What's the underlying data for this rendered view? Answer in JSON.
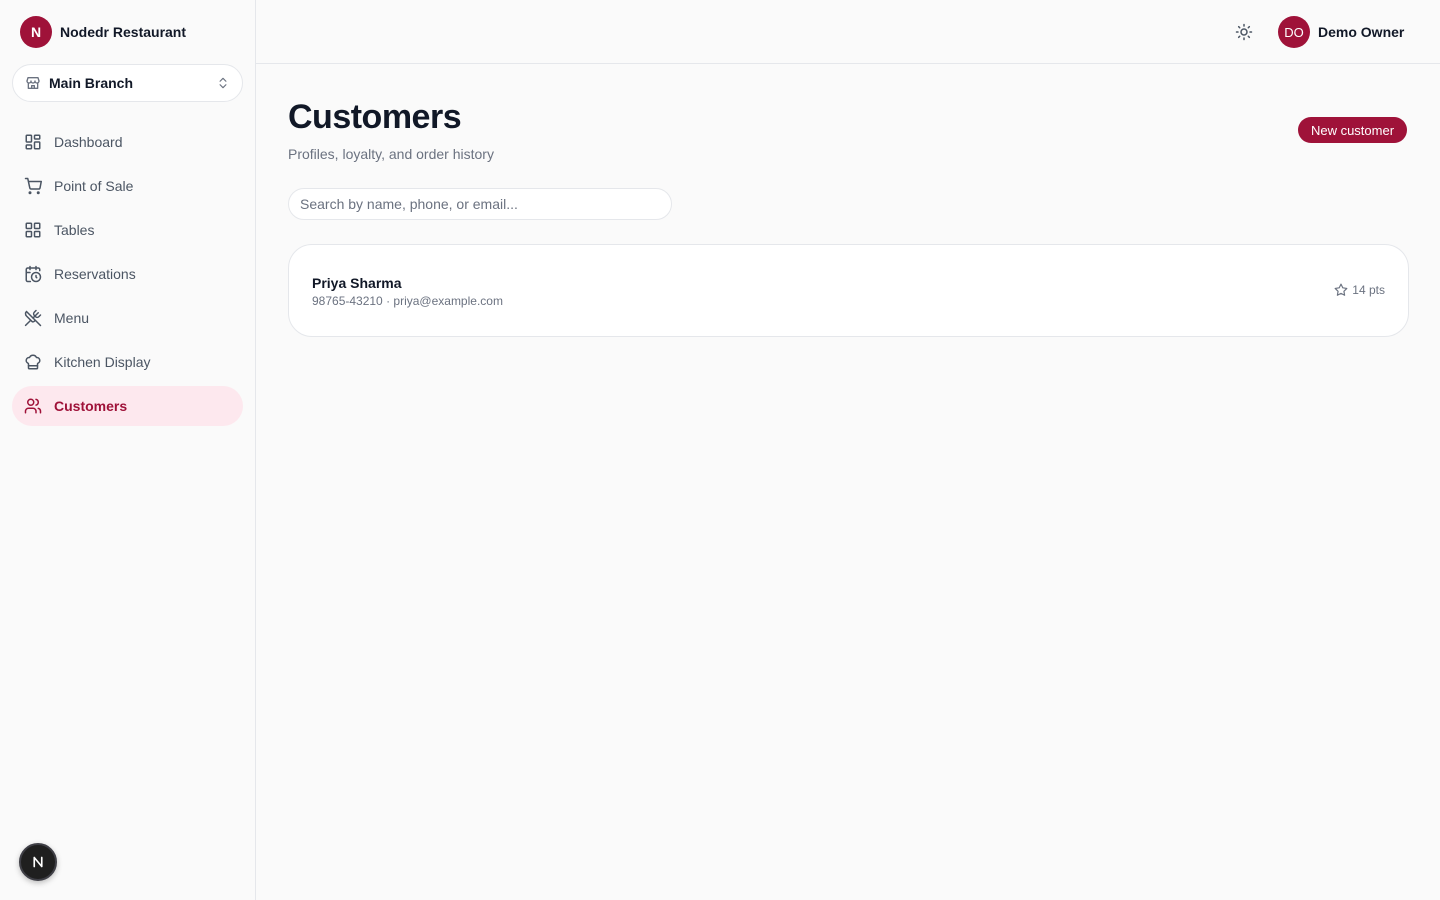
{
  "brand": {
    "logo_letter": "N",
    "name": "Nodedr Restaurant"
  },
  "branch_selector": {
    "label": "Main Branch",
    "icon": "store-icon"
  },
  "sidebar": {
    "items": [
      {
        "label": "Dashboard",
        "icon": "dashboard-icon",
        "active": false
      },
      {
        "label": "Point of Sale",
        "icon": "cart-icon",
        "active": false
      },
      {
        "label": "Tables",
        "icon": "grid-icon",
        "active": false
      },
      {
        "label": "Reservations",
        "icon": "calendar-clock-icon",
        "active": false
      },
      {
        "label": "Menu",
        "icon": "utensils-icon",
        "active": false
      },
      {
        "label": "Kitchen Display",
        "icon": "chef-hat-icon",
        "active": false
      },
      {
        "label": "Customers",
        "icon": "users-icon",
        "active": true
      }
    ]
  },
  "header": {
    "theme_toggle_icon": "sun-icon",
    "user": {
      "initials": "DO",
      "name": "Demo Owner"
    }
  },
  "page": {
    "title": "Customers",
    "subtitle": "Profiles, loyalty, and order history",
    "new_button_label": "New customer",
    "search_placeholder": "Search by name, phone, or email..."
  },
  "customers": [
    {
      "name": "Priya Sharma",
      "meta": "98765-43210 · priya@example.com",
      "points": "14 pts"
    }
  ],
  "colors": {
    "accent": "#9f1239",
    "accent_bg": "#fde8ee",
    "text": "#111827",
    "muted": "#6b7280",
    "border": "#e5e7eb"
  }
}
